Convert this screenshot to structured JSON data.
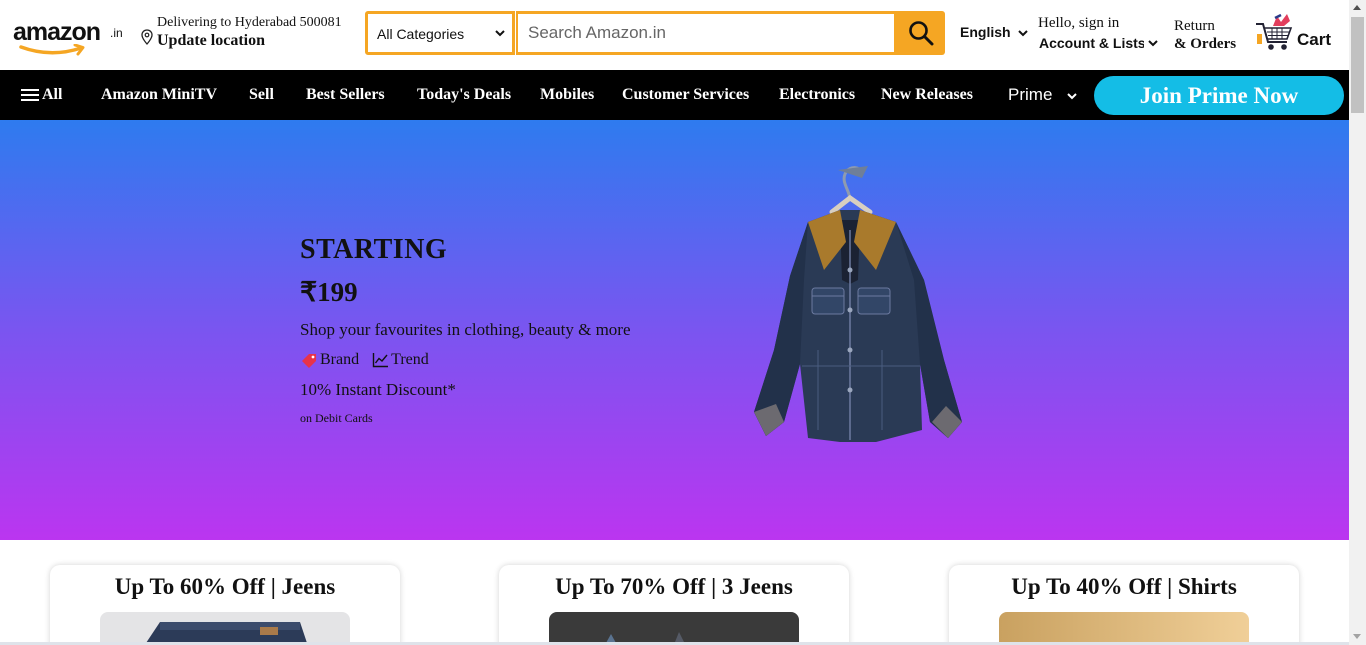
{
  "header": {
    "logo_text": "amazon",
    "logo_tld": ".in",
    "delivery_line1": "Delivering to Hyderabad 500081",
    "delivery_line2": "Update location",
    "search": {
      "category": "All Categories",
      "placeholder": "Search Amazon.in"
    },
    "language": "English",
    "account_line1": "Hello, sign in",
    "account_line2": "Account & Lists",
    "returns_line1": "Return",
    "returns_line2": "& Orders",
    "cart_label": "Cart",
    "accent_color": "#f5a623"
  },
  "nav": {
    "all_label": "All",
    "items": [
      "Amazon MiniTV",
      "Sell",
      "Best Sellers",
      "Today's Deals",
      "Mobiles",
      "Customer Services",
      "Electronics",
      "New Releases"
    ],
    "prime_label": "Prime",
    "join_label": "Join Prime Now",
    "join_color": "#14bde6"
  },
  "hero": {
    "title": "STARTING",
    "price": "₹199",
    "subtitle": "Shop your favourites in clothing, beauty & more",
    "tag_brand": "Brand",
    "tag_trend": "Trend",
    "discount": "10% Instant Discount*",
    "discount_note": "on Debit Cards",
    "gradient_top": "#2e7bef",
    "gradient_bottom": "#bb35f0"
  },
  "cards": [
    {
      "title": "Up To 60% Off | Jeens"
    },
    {
      "title": "Up To 70% Off | 3 Jeens"
    },
    {
      "title": "Up To 40% Off | Shirts"
    }
  ]
}
